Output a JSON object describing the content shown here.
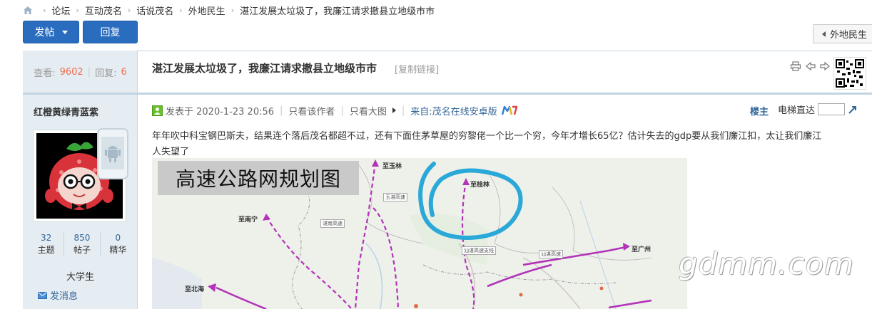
{
  "breadcrumb": {
    "items": [
      "论坛",
      "互动茂名",
      "话说茂名",
      "外地民生",
      "湛江发展太垃圾了，我廉江请求撤县立地级市市"
    ],
    "separator": "›"
  },
  "actions": {
    "post_label": "发帖",
    "reply_label": "回复",
    "back_label": "外地民生"
  },
  "thread": {
    "views_label": "查看:",
    "views": "9602",
    "replies_label": "回复:",
    "replies": "6",
    "title": "湛江发展太垃圾了，我廉江请求撤县立地级市市",
    "copy_link": "[复制链接]"
  },
  "author": {
    "name": "红橙黄绿青蓝紫",
    "stats": [
      {
        "value": "32",
        "label": "主题"
      },
      {
        "value": "850",
        "label": "帖子"
      },
      {
        "value": "0",
        "label": "精华"
      }
    ],
    "group": "大学生",
    "send_message": "发消息"
  },
  "post": {
    "posted_at": "发表于 2020-1-23 20:56",
    "only_author": "只看该作者",
    "big_image": "只看大图",
    "source": "来自:茂名在线安卓版",
    "floor": "楼主",
    "jump_label": "电梯直达",
    "body": "年年吹中科宝钢巴斯夫，结果连个落后茂名都超不过，还有下面住茅草屋的穷黎佬一个比一个穷，今年才增长65亿？估计失去的gdp要从我们廉江扣，太让我们廉江人失望了"
  },
  "map": {
    "title": "高速公路网规划图",
    "labels": [
      "至玉林",
      "至桂林",
      "至南宁",
      "至广州",
      "至北海"
    ],
    "road_tags": [
      "玉湛高速",
      "湛南高速",
      "汕湛高速支线",
      "汕湛高速"
    ]
  },
  "watermark": "gdmm.com",
  "colors": {
    "accent_blue": "#2a6dbf",
    "link_blue": "#336699",
    "highlight_red": "#f26c4f",
    "sidebar_bg": "#e5edf2",
    "border": "#c2d5e3",
    "map_route": "#b233b8",
    "annotation_circle": "#2aa8d8"
  },
  "icons": [
    "home-icon",
    "print-icon",
    "prev-thread-icon",
    "next-thread-icon",
    "qr-code-icon",
    "android-icon",
    "online-status-icon",
    "mobile-app-logo-icon",
    "jump-go-icon",
    "mail-icon"
  ]
}
